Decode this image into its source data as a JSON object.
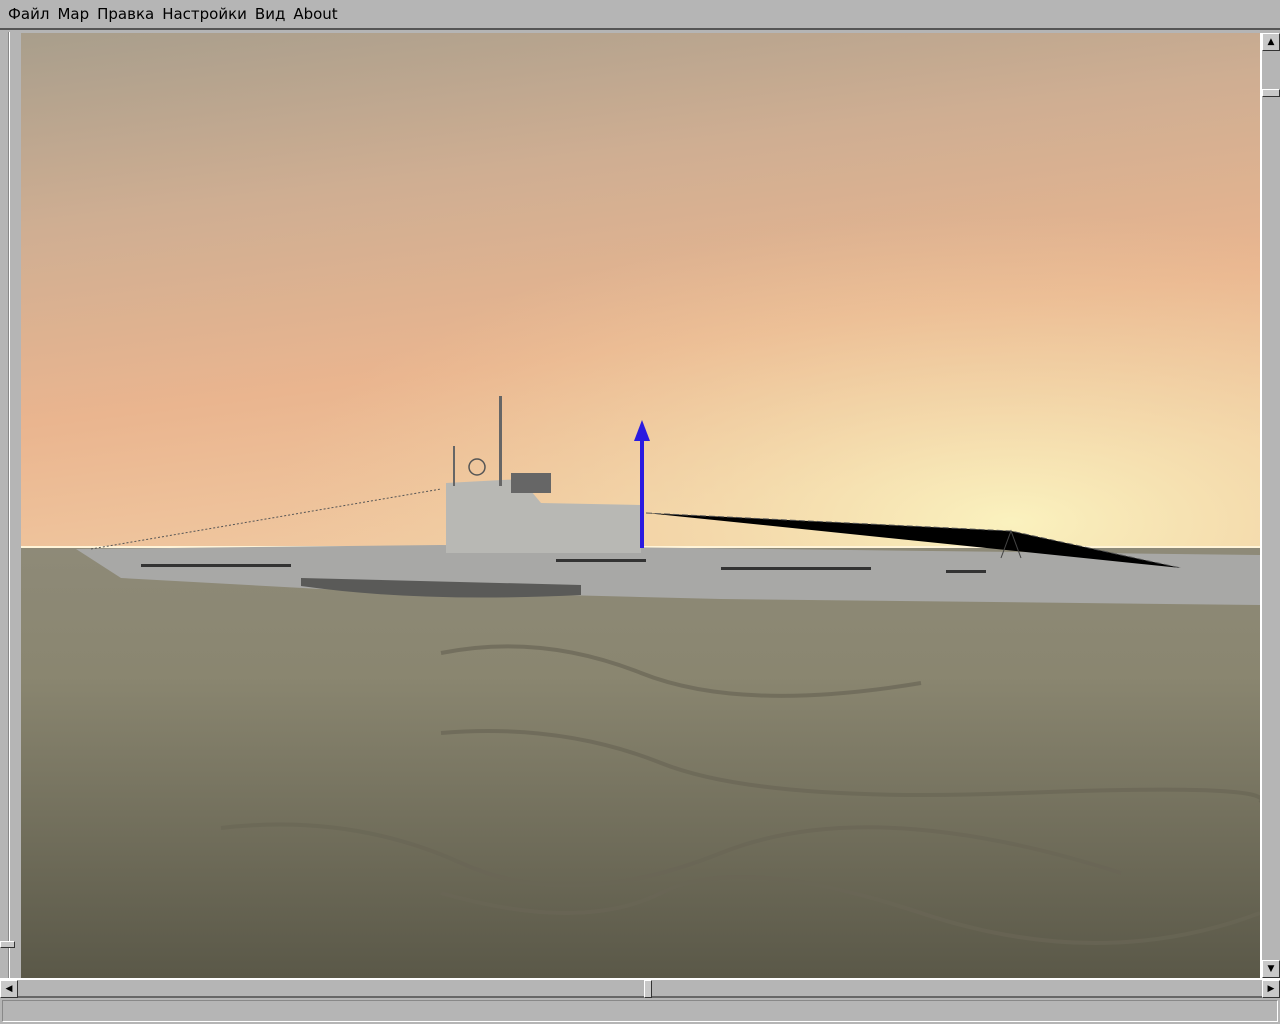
{
  "menu": {
    "items": [
      "Файл",
      "Мар",
      "Правка",
      "Настройки",
      "Вид",
      "About"
    ]
  },
  "scrollbars": {
    "up_icon": "arrow-up-icon",
    "down_icon": "arrow-down-icon",
    "left_icon": "arrow-left-icon",
    "right_icon": "arrow-right-icon"
  },
  "statusbar": {
    "text": ""
  }
}
